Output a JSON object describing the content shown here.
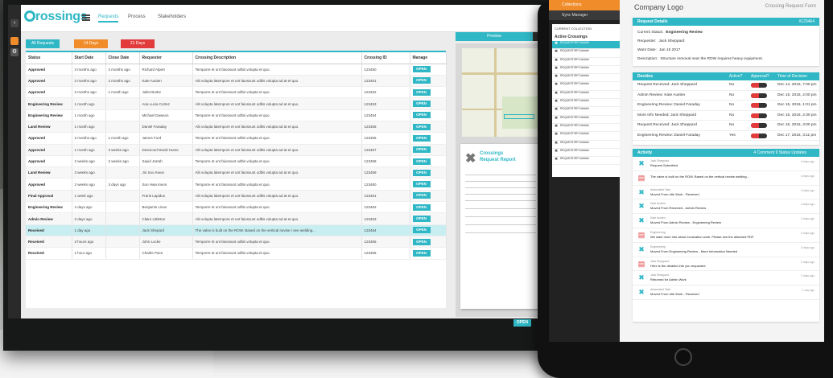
{
  "desktop": {
    "logo": "rossings",
    "nav_tabs": [
      "Requests",
      "Process",
      "Stakeholders"
    ],
    "filters": [
      {
        "label": "All Requests",
        "color": "#2fb7c5"
      },
      {
        "label": "14 Days",
        "color": "#f08c2a"
      },
      {
        "label": "21 Days",
        "color": "#e23b3b"
      }
    ],
    "columns": [
      "Status",
      "Start Date",
      "Close Date",
      "Requester",
      "Crossing Description",
      "Crossing ID",
      "Manage"
    ],
    "open_label": "OPEN",
    "rows": [
      {
        "status": "Approved",
        "start": "3 months ago",
        "close": "2 months ago",
        "requester": "Richard Alpert",
        "desc": "Temporre et unt faiossunt odltis volupta et quo.",
        "id": "123450",
        "hl": false
      },
      {
        "status": "Approved",
        "start": "2 months ago",
        "close": "2 months ago",
        "requester": "Kate Austen",
        "desc": "Alit volupta latempore et unt faiossunt odltis volupta ad at et quo.",
        "id": "123451",
        "hl": false
      },
      {
        "status": "Approved",
        "start": "2 months ago",
        "close": "1 month ago",
        "requester": "Juliet Burke",
        "desc": "Temporre et unt faiossunt odltis volupta et quo.",
        "id": "123452",
        "hl": false
      },
      {
        "status": "Engineering Review",
        "start": "1 month ago",
        "close": "",
        "requester": "Ana Lucia Cortez",
        "desc": "Alit volupta latempore et unt faiossunt odltis volupta ad at et quo.",
        "id": "123453",
        "hl": false
      },
      {
        "status": "Engineering Review",
        "start": "1 month ago",
        "close": "",
        "requester": "Michael Dawson",
        "desc": "Temporre et unt faiossunt odltis volupta et quo.",
        "id": "123454",
        "hl": false
      },
      {
        "status": "Land Review",
        "start": "1 month ago",
        "close": "",
        "requester": "Daniel Faraday",
        "desc": "Alit volupta latempore et unt faiossunt odltis volupta ad at et quo.",
        "id": "123455",
        "hl": false
      },
      {
        "status": "Approved",
        "start": "2 months ago",
        "close": "1 month ago",
        "requester": "James Ford",
        "desc": "Temporre et unt faiossunt odltis volupta et quo.",
        "id": "123456",
        "hl": false
      },
      {
        "status": "Approved",
        "start": "1 month ago",
        "close": "3 weeks ago",
        "requester": "Desmond David Hume",
        "desc": "Alit volupta latempore et unt faiossunt odltis volupta ad at et quo.",
        "id": "123457",
        "hl": false
      },
      {
        "status": "Approved",
        "start": "2 weeks ago",
        "close": "2 weeks ago",
        "requester": "Sayid Jarrah",
        "desc": "Temporre et unt faiossunt odltis volupta et quo.",
        "id": "123458",
        "hl": false
      },
      {
        "status": "Land Review",
        "start": "3 weeks ago",
        "close": "",
        "requester": "Jin Soo Kwon",
        "desc": "Alit volupta latempore et unt faiossunt odltis volupta ad at et quo.",
        "id": "123459",
        "hl": false
      },
      {
        "status": "Approved",
        "start": "2 weeks ago",
        "close": "3 days ago",
        "requester": "Sun Hwa Kwon",
        "desc": "Temporre et unt faiossunt odltis volupta et quo.",
        "id": "123460",
        "hl": false
      },
      {
        "status": "Final Approval",
        "start": "1 week ago",
        "close": "",
        "requester": "Frank Lapidus",
        "desc": "Alit volupta latempore et unt faiossunt odltis volupta ad at et quo.",
        "id": "123461",
        "hl": false
      },
      {
        "status": "Engineering Review",
        "start": "4 days ago",
        "close": "",
        "requester": "Benjamin Linus",
        "desc": "Temporre et unt faiossunt odltis volupta et quo.",
        "id": "123462",
        "hl": false
      },
      {
        "status": "Admin Review",
        "start": "3 days ago",
        "close": "",
        "requester": "Claire Littleton",
        "desc": "Alit volupta latempore et unt faiossunt odltis volupta ad at et quo.",
        "id": "123463",
        "hl": false
      },
      {
        "status": "Received",
        "start": "1 day ago",
        "close": "",
        "requester": "Jack Shepard",
        "desc": "The valve is built on the ROW. Based on the vertical nevise I see welding...",
        "id": "123464",
        "hl": true
      },
      {
        "status": "Received",
        "start": "2 hours ago",
        "close": "",
        "requester": "John Locke",
        "desc": "Temporre et unt faiossunt odltis volupta et quo.",
        "id": "123465",
        "hl": false
      },
      {
        "status": "Received",
        "start": "1 hour ago",
        "close": "",
        "requester": "Charlie Pace",
        "desc": "Temporre et unt faiossunt odltis volupta et quo.",
        "id": "123466",
        "hl": false
      }
    ],
    "preview_tab": "Preview",
    "report_title_1": "Crossings",
    "report_title_2": "Request Report",
    "preview_open": "OPEN"
  },
  "tablet": {
    "sidebar_top": "Collections",
    "sidebar_manager": "Sync Manager",
    "panel_header": "CURRENT COLLECTION",
    "panel_active": "Active Crossings",
    "panel_items": [
      "REQUEST/RFC/#####",
      "REQUEST/RFC/#####",
      "REQUEST/RFC/#####",
      "REQUEST/RFC/#####",
      "REQUEST/RFC/#####",
      "REQUEST/RFC/#####",
      "REQUEST/RFC/#####",
      "REQUEST/RFC/#####",
      "REQUEST/RFC/#####",
      "REQUEST/RFC/#####",
      "REQUEST/RFC/#####",
      "REQUEST/RFC/#####",
      "REQUEST/RFC/#####",
      "REQUEST/RFC/#####",
      "REQUEST/RFC/#####"
    ],
    "company_logo": "Company Logo",
    "form_title": "Crossing Request Form",
    "details": {
      "header": "Request Details",
      "id": "#123464",
      "rows": [
        {
          "label": "Current Status:",
          "value": "Engineering Review"
        },
        {
          "label": "Requester:",
          "value": "Jack Sheppard"
        },
        {
          "label": "Want Date:",
          "value": "Jan 15 2017"
        },
        {
          "label": "Description:",
          "value": "Structure removal near the ROW requires heavy equipment."
        }
      ]
    },
    "decisions": {
      "header": "Decides",
      "cols": [
        "Active?",
        "Approval?",
        "Time of Decision"
      ],
      "rows": [
        {
          "name": "Request Received: Jack Sheppard",
          "active": "No",
          "time": "Dec 14, 2016, 7:00 pm"
        },
        {
          "name": "Admin Review: Kate Austen",
          "active": "No",
          "time": "Dec 15, 2016, 2:00 pm"
        },
        {
          "name": "Engineering Review: Daniel Faraday",
          "active": "No",
          "time": "Dec 15, 2016, 1:01 pm"
        },
        {
          "name": "More Info Needed: Jack Sheppard",
          "active": "No",
          "time": "Dec 15, 2016, 2:30 pm"
        },
        {
          "name": "Request Received: Jack Sheppard",
          "active": "No",
          "time": "Dec 16, 2016, 3:00 pm"
        },
        {
          "name": "Engineering Review: Daniel Faraday",
          "active": "Yes",
          "time": "Dec 17, 2016, 3:11 pm"
        }
      ]
    },
    "activity": {
      "header": "Activity",
      "summary": "4 Comment 9 Status Updates",
      "rows": [
        {
          "icon": "x",
          "who": "Jack Sheppard",
          "text": "Request Submitted",
          "time": "4 days ago"
        },
        {
          "icon": "pdf",
          "who": "",
          "text": "The valve is built on the ROW. Based on the vertical nevise welding...",
          "time": "4 days ago"
        },
        {
          "icon": "x",
          "who": "Automated Task",
          "text": "Moved From Idle Work - Received",
          "time": "4 days ago"
        },
        {
          "icon": "x",
          "who": "Kate Austen",
          "text": "Moved From Received - Admin Review",
          "time": "4 days ago"
        },
        {
          "icon": "x",
          "who": "Kate Austen",
          "text": "Moved From Admin Review - Engineering Review",
          "time": "4 days ago"
        },
        {
          "icon": "pdf",
          "who": "Engineering",
          "text": "We want more info about excavation work. Please see the attached PDF.",
          "time": "3 days ago"
        },
        {
          "icon": "x",
          "who": "Engineering",
          "text": "Moved From Engineering Review - More Information Needed",
          "time": "3 days ago"
        },
        {
          "icon": "pdf",
          "who": "Jack Sheppard",
          "text": "Here is the detailed info you requested",
          "time": "2 days ago"
        },
        {
          "icon": "x",
          "who": "Jack Sheppard",
          "text": "Returned for Admin Work",
          "time": "2 days ago"
        },
        {
          "icon": "x",
          "who": "Automated Task",
          "text": "Moved From Idle Work - Received",
          "time": "1 day ago"
        }
      ]
    }
  }
}
